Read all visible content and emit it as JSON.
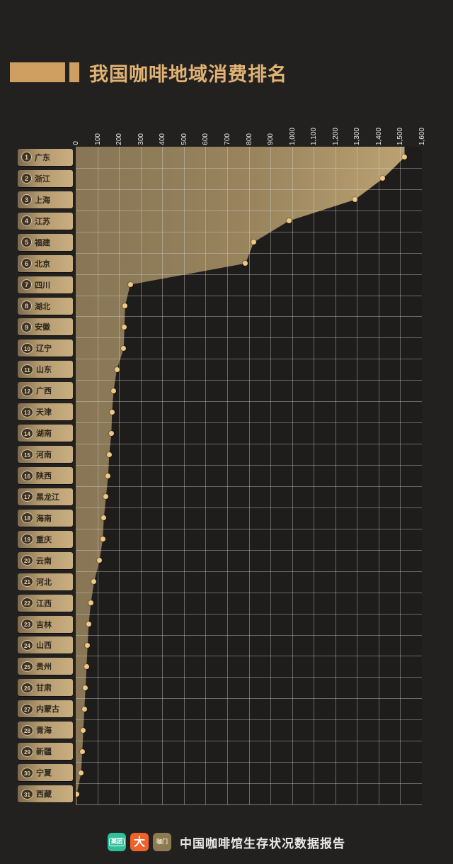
{
  "header": {
    "title": "我国咖啡地域消费排名"
  },
  "footer": {
    "logos": [
      {
        "name": "meituan-logo",
        "text": "美团"
      },
      {
        "name": "dianping-logo",
        "text": "大"
      },
      {
        "name": "kamen-logo",
        "text": "咖门"
      }
    ],
    "text": "中国咖啡馆生存状况数据报告"
  },
  "chart_data": {
    "type": "bar",
    "title": "我国咖啡地域消费排名",
    "xlabel": "",
    "ylabel": "",
    "xlim": [
      0,
      1600
    ],
    "grid": true,
    "legend": "none",
    "orientation": "horizontal",
    "accent_color": "#f0c882",
    "area_fill_color": "#b49a6f",
    "background_color": "#23211f",
    "xticks": [
      "0",
      "100",
      "200",
      "300",
      "400",
      "500",
      "600",
      "700",
      "800",
      "900",
      "1,000",
      "1,100",
      "1,200",
      "1,300",
      "1,400",
      "1,500",
      "1,600"
    ],
    "xtick_values": [
      0,
      100,
      200,
      300,
      400,
      500,
      600,
      700,
      800,
      900,
      1000,
      1100,
      1200,
      1300,
      1400,
      1500,
      1600
    ],
    "categories": [
      "广东",
      "浙江",
      "上海",
      "江苏",
      "福建",
      "北京",
      "四川",
      "湖北",
      "安徽",
      "辽宁",
      "山东",
      "广西",
      "天津",
      "湖南",
      "河南",
      "陕西",
      "黑龙江",
      "海南",
      "重庆",
      "云南",
      "河北",
      "江西",
      "吉林",
      "山西",
      "贵州",
      "甘肃",
      "内蒙古",
      "青海",
      "新疆",
      "宁夏",
      "西藏"
    ],
    "ranks": [
      1,
      2,
      3,
      4,
      5,
      6,
      7,
      8,
      9,
      10,
      11,
      12,
      13,
      14,
      15,
      16,
      17,
      18,
      19,
      20,
      21,
      22,
      23,
      24,
      25,
      26,
      27,
      28,
      29,
      30,
      31
    ],
    "values": [
      1520,
      1420,
      1290,
      985,
      823,
      785,
      252,
      228,
      225,
      222,
      190,
      175,
      168,
      165,
      155,
      150,
      140,
      130,
      125,
      110,
      85,
      70,
      60,
      55,
      50,
      45,
      40,
      35,
      30,
      25,
      5
    ]
  }
}
